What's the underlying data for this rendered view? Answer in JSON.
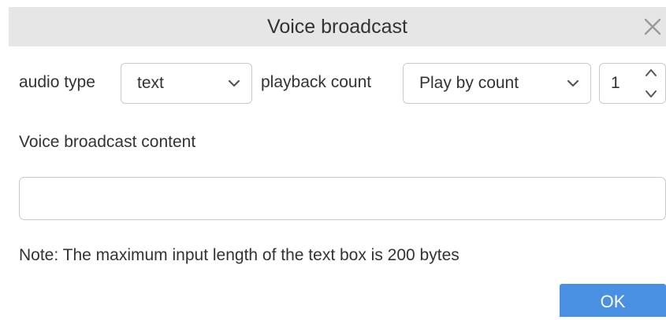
{
  "dialog": {
    "title": "Voice broadcast",
    "close_icon": "close-icon"
  },
  "form": {
    "audio_type_label": "audio type",
    "audio_type_value": "text",
    "playback_count_label": "playback count",
    "playback_count_value": "Play by count",
    "count_value": "1",
    "content_label": "Voice broadcast content",
    "content_value": "",
    "note": "Note: The maximum input length of the text box is 200 bytes"
  },
  "actions": {
    "ok_label": "OK"
  },
  "colors": {
    "titlebar_bg": "#e6e6e6",
    "primary_button": "#4a90e2",
    "border": "#c9c9c9",
    "text": "#333333"
  },
  "icons": [
    "close-icon",
    "chevron-down-icon",
    "stepper-up-icon",
    "stepper-down-icon"
  ]
}
